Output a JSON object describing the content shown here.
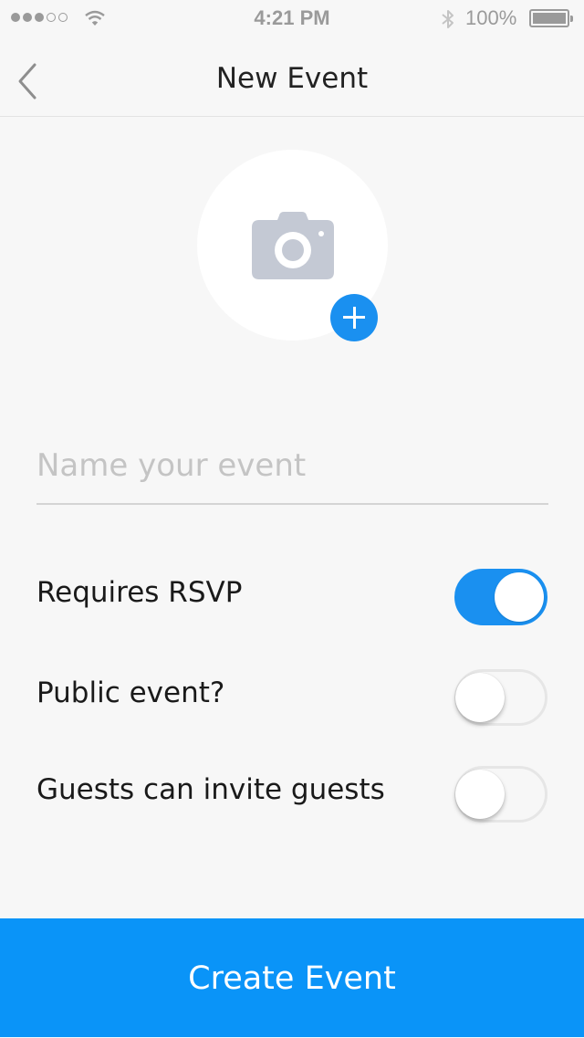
{
  "status_bar": {
    "signal_dots": 5,
    "signal_filled": 3,
    "time": "4:21 PM",
    "battery_percent": "100%",
    "icons": [
      "signal-dots-icon",
      "wifi-icon",
      "bluetooth-icon",
      "battery-icon"
    ]
  },
  "nav": {
    "title": "New Event",
    "back_icon": "chevron-left-icon"
  },
  "photo": {
    "icon": "camera-icon",
    "add_icon": "plus-icon",
    "accent_color": "#1a90f0",
    "icon_color": "#c4c9d4"
  },
  "event_name": {
    "placeholder": "Name your event",
    "value": ""
  },
  "settings": [
    {
      "label": "Requires RSVP",
      "enabled": true
    },
    {
      "label": "Public event?",
      "enabled": false
    },
    {
      "label": "Guests can invite guests",
      "enabled": false
    }
  ],
  "primary_action": {
    "label": "Create Event",
    "color": "#0a94f8"
  }
}
